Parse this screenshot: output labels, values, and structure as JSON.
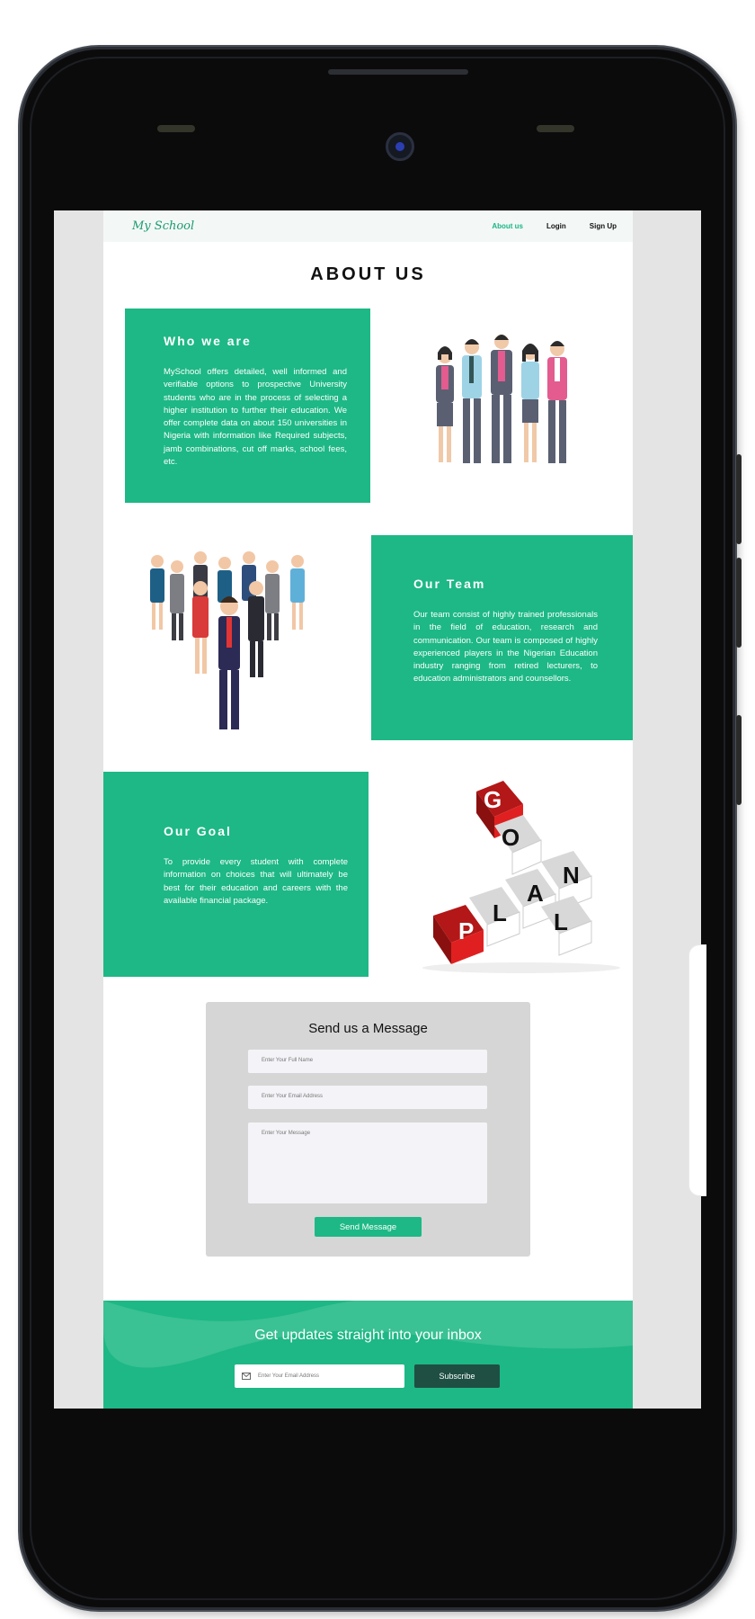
{
  "navbar": {
    "logo": "My School",
    "links": [
      "About us",
      "Login",
      "Sign Up"
    ]
  },
  "page_title": "ABOUT US",
  "sections": [
    {
      "heading": "Who we are",
      "text": "MySchool offers detailed, well informed and verifiable options to prospective University students who are in the process of selecting a higher institution to further their education. We offer complete data on about 150 universities in Nigeria with information like Required subjects, jamb combinations, cut off marks, school fees, etc."
    },
    {
      "heading": "Our Team",
      "text": "Our team consist of highly trained professionals in the field of education, research and communication. Our team is composed of highly experienced players in the Nigerian Education industry ranging from retired lecturers, to education administrators and counsellors."
    },
    {
      "heading": "Our Goal",
      "text": "To provide every student with complete information on choices that will ultimately be best for their education and careers with the available financial package."
    }
  ],
  "contact": {
    "title": "Send us a Message",
    "name_placeholder": "Enter Your Full Name",
    "email_placeholder": "Enter Your Email Address",
    "message_placeholder": "Enter Your Message",
    "send_label": "Send Message"
  },
  "newsletter": {
    "title": "Get updates straight into your  inbox",
    "email_placeholder": "Enter Your Email Address",
    "subscribe_label": "Subscribe"
  },
  "goal_image_letters": {
    "row": [
      "P",
      "L",
      "A",
      "N"
    ],
    "column": [
      "G",
      "O",
      "A",
      "L"
    ]
  },
  "colors": {
    "accent": "#1db885",
    "dark_button": "#1f4f43",
    "card_gray": "#d6d6d6",
    "cube_red": "#e02020"
  }
}
